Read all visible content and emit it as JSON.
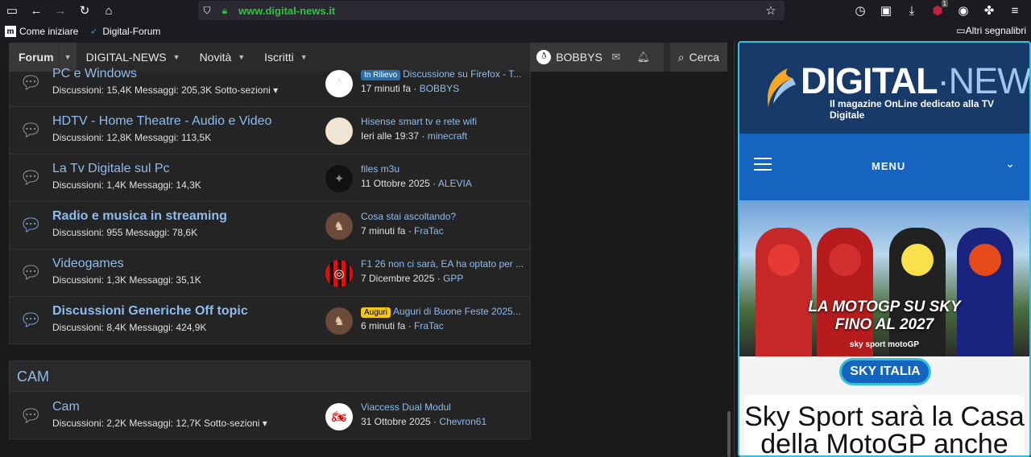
{
  "browser": {
    "url": "www.digital-news.it",
    "bookmarks": [
      {
        "label": "Come iniziare"
      },
      {
        "label": "Digital-Forum"
      }
    ],
    "other_bookmarks": "Altri segnalibri",
    "extension_badge": "1"
  },
  "forum": {
    "nav": {
      "tabs": [
        {
          "label": "Forum"
        },
        {
          "label": "DIGITAL-NEWS"
        },
        {
          "label": "Novità"
        },
        {
          "label": "Iscritti"
        }
      ],
      "user": "BOBBYS",
      "search": "Cerca"
    },
    "nodes": [
      {
        "title": "PC e Windows",
        "stats": "Discussioni: 15,4K Messaggi: 205,3K Sotto-sezioni ▾",
        "unread": false,
        "latest_label": "In Rilievo",
        "latest_title": "Discussione su Firefox - T...",
        "latest_time": "17 minuti fa",
        "latest_user": "BOBBYS"
      },
      {
        "title": "HDTV - Home Theatre - Audio e Video",
        "stats": "Discussioni: 12,8K Messaggi: 113,5K",
        "unread": false,
        "latest_label": "",
        "latest_title": "Hisense smart tv e rete wifi",
        "latest_time": "Ieri alle 19:37",
        "latest_user": "minecraft"
      },
      {
        "title": "La Tv Digitale sul Pc",
        "stats": "Discussioni: 1,4K Messaggi: 14,3K",
        "unread": false,
        "latest_label": "",
        "latest_title": "files m3u",
        "latest_time": "11 Ottobre 2025",
        "latest_user": "ALEVIA"
      },
      {
        "title": "Radio e musica in streaming",
        "stats": "Discussioni: 955 Messaggi: 78,6K",
        "unread": true,
        "latest_label": "",
        "latest_title": "Cosa stai ascoltando?",
        "latest_time": "7 minuti fa",
        "latest_user": "FraTac"
      },
      {
        "title": "Videogames",
        "stats": "Discussioni: 1,3K Messaggi: 35,1K",
        "unread": false,
        "latest_label": "",
        "latest_title": "F1 26 non ci sarà, EA ha optato per ...",
        "latest_time": "7 Dicembre 2025",
        "latest_user": "GPP"
      },
      {
        "title": "Discussioni Generiche Off topic",
        "stats": "Discussioni: 8,4K Messaggi: 424,9K",
        "unread": true,
        "latest_label": "Auguri",
        "latest_title": "Auguri di Buone Feste 2025...",
        "latest_time": "6 minuti fa",
        "latest_user": "FraTac"
      }
    ],
    "category": {
      "title": "CAM",
      "node": {
        "title": "Cam",
        "stats": "Discussioni: 2,2K Messaggi: 12,7K Sotto-sezioni ▾",
        "latest_title": "Viaccess Dual Modul",
        "latest_time": "31 Ottobre 2025",
        "latest_user": "Chevron61"
      }
    }
  },
  "news": {
    "logo_bold": "DIGITAL",
    "logo_dot": "·",
    "logo_light": "NEWS",
    "tagline": "Il magazine OnLine dedicato alla TV Digitale",
    "menu_label": "MENU",
    "hero_line1": "LA MOTOGP SU SKY",
    "hero_line2": "FINO AL 2027",
    "hero_sub": "sky sport motoGP",
    "pill": "SKY ITALIA",
    "article_title": "Sky Sport sarà la Casa della MotoGP anche"
  }
}
